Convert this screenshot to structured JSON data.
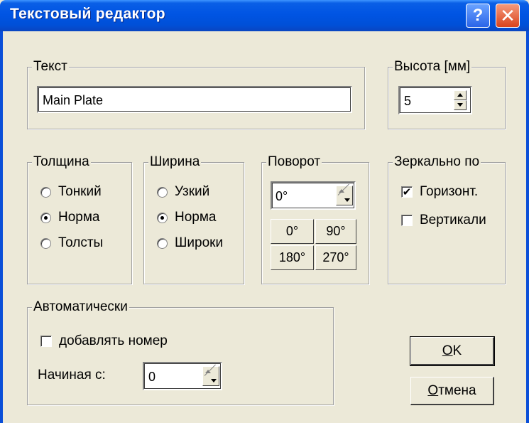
{
  "window": {
    "title": "Текстовый редактор",
    "help_glyph": "?",
    "close_glyph": "✕",
    "accent": "#0054e3",
    "face_color": "#ece9d8"
  },
  "text_group": {
    "legend": "Текст",
    "value": "Main Plate"
  },
  "height_group": {
    "legend": "Высота [мм]",
    "value": "5"
  },
  "thickness_group": {
    "legend": "Толщина",
    "options": [
      {
        "label": "Тонкий",
        "selected": false
      },
      {
        "label": "Норма",
        "selected": true
      },
      {
        "label": "Толсты",
        "selected": false
      }
    ]
  },
  "width_group": {
    "legend": "Ширина",
    "options": [
      {
        "label": "Узкий",
        "selected": false
      },
      {
        "label": "Норма",
        "selected": true
      },
      {
        "label": "Широки",
        "selected": false
      }
    ]
  },
  "rotation_group": {
    "legend": "Поворот",
    "value": "0°",
    "buttons": [
      "0°",
      "90°",
      "180°",
      "270°"
    ]
  },
  "mirror_group": {
    "legend": "Зеркально по",
    "options": [
      {
        "label": "Горизонт.",
        "checked": true
      },
      {
        "label": "Вертикали",
        "checked": false
      }
    ]
  },
  "auto_group": {
    "legend": "Автоматически",
    "add_number_label": "добавлять номер",
    "add_number_checked": false,
    "start_label": "Начиная с:",
    "start_value": "0"
  },
  "buttons": {
    "ok_mnemonic": "O",
    "ok_rest": "K",
    "cancel_mnemonic": "О",
    "cancel_rest": "тмена"
  }
}
